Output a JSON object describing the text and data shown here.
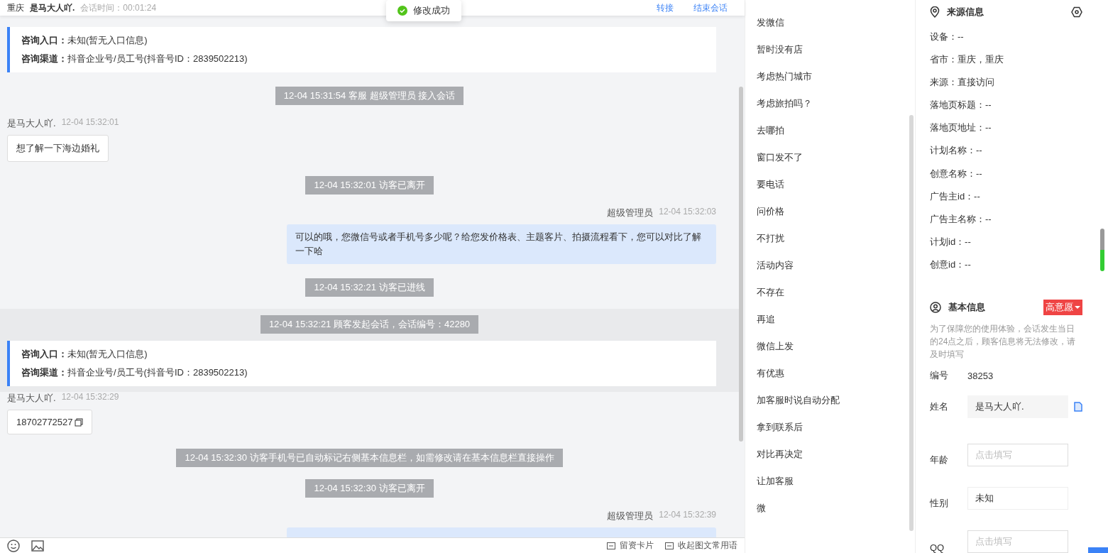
{
  "header": {
    "location": "重庆",
    "visitor": "是马大人吖.",
    "session_time": "会话时间：00:01:24",
    "actions": [
      "转接",
      "结束会话"
    ]
  },
  "toast": "修改成功",
  "messages": [
    {
      "kind": "info",
      "highlighted": false,
      "lines": [
        {
          "label": "咨询入口：",
          "value": "未知(暂无入口信息)"
        },
        {
          "label": "咨询渠道：",
          "value": "抖音企业号/员工号(抖音号ID：2839502213)"
        }
      ]
    },
    {
      "kind": "system",
      "highlighted": false,
      "text": "12-04 15:31:54 客服 超级管理员 接入会话"
    },
    {
      "kind": "visitor",
      "name": "是马大人吖.",
      "time": "12-04 15:32:01",
      "text": "想了解一下海边婚礼",
      "copy": false
    },
    {
      "kind": "system",
      "highlighted": false,
      "text": "12-04 15:32:01 访客已离开"
    },
    {
      "kind": "agent",
      "name": "超级管理员",
      "time": "12-04 15:32:03",
      "text": "可以的哦，您微信号或者手机号多少呢？给您发价格表、主题客片、拍摄流程看下，您可以对比了解一下哈"
    },
    {
      "kind": "system",
      "highlighted": false,
      "text": "12-04 15:32:21 访客已进线"
    },
    {
      "kind": "system",
      "highlighted": true,
      "text": "12-04 15:32:21 顾客发起会话，会话编号：42280"
    },
    {
      "kind": "info",
      "highlighted": true,
      "lines": [
        {
          "label": "咨询入口：",
          "value": "未知(暂无入口信息)"
        },
        {
          "label": "咨询渠道：",
          "value": "抖音企业号/员工号(抖音号ID：2839502213)"
        }
      ]
    },
    {
      "kind": "visitor",
      "name": "是马大人吖.",
      "time": "12-04 15:32:29",
      "text": "18702772527",
      "copy": true
    },
    {
      "kind": "system",
      "highlighted": false,
      "text": "12-04 15:32:30 访客手机号已自动标记右侧基本信息栏，如需修改请在基本信息栏直接操作"
    },
    {
      "kind": "system",
      "highlighted": false,
      "text": "12-04 15:32:30 访客已离开"
    },
    {
      "kind": "agent",
      "name": "超级管理员",
      "time": "12-04 15:32:39"
    }
  ],
  "toolbar": {
    "links": [
      "留资卡片",
      "收起图文常用语"
    ]
  },
  "quick_replies": [
    "发微信",
    "暂时没有店",
    "考虑热门城市",
    "考虑旅拍吗？",
    "去哪拍",
    "窗口发不了",
    "要电话",
    "问价格",
    "不打扰",
    "活动内容",
    "不存在",
    "再追",
    "微信上发",
    "有优惠",
    "加客服时说自动分配",
    "拿到联系后",
    "对比再决定",
    "让加客服",
    "微"
  ],
  "source_info": {
    "title": "来源信息",
    "rows": [
      "设备：--",
      "省市：重庆，重庆",
      "来源：直接访问",
      "落地页标题：--",
      "落地页地址：--",
      "计划名称：--",
      "创意名称：--",
      "广告主id：--",
      "广告主名称：--",
      "计划id：--",
      "创意id：--"
    ]
  },
  "basic_info": {
    "title": "基本信息",
    "intent": "高意愿",
    "notice": "为了保障您的使用体验，会话发生当日的24点之后，顾客信息将无法修改，请及时填写",
    "fields": [
      {
        "kind": "text",
        "label": "编号",
        "value": "38253"
      },
      {
        "kind": "readonly",
        "label": "姓名",
        "value": "是马大人吖."
      },
      {
        "kind": "input",
        "label": "年龄",
        "placeholder": "点击填写"
      },
      {
        "kind": "select",
        "label": "性别",
        "value": "未知"
      },
      {
        "kind": "input",
        "label": "QQ",
        "placeholder": "点击填写"
      }
    ]
  }
}
